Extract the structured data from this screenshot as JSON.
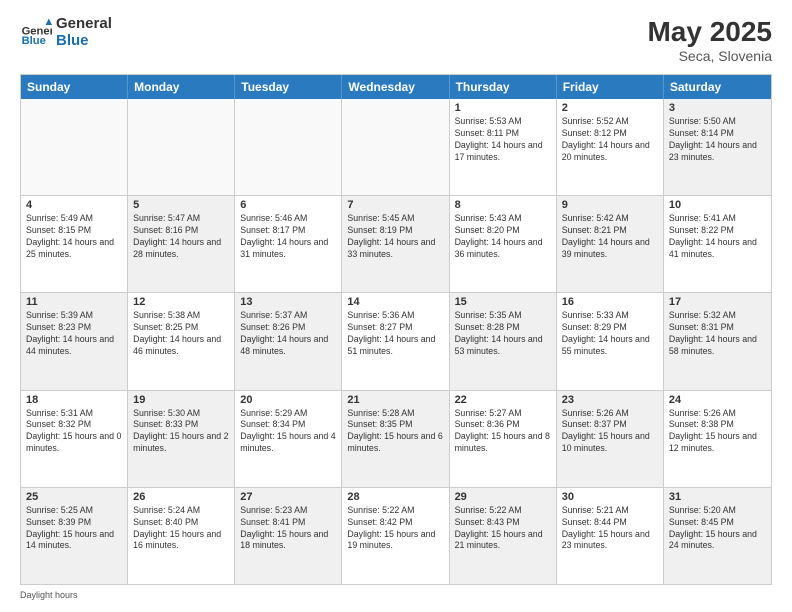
{
  "header": {
    "logo_general": "General",
    "logo_blue": "Blue",
    "month_year": "May 2025",
    "location": "Seca, Slovenia"
  },
  "days_of_week": [
    "Sunday",
    "Monday",
    "Tuesday",
    "Wednesday",
    "Thursday",
    "Friday",
    "Saturday"
  ],
  "rows": [
    [
      {
        "day": "",
        "info": "",
        "shade": true
      },
      {
        "day": "",
        "info": "",
        "shade": true
      },
      {
        "day": "",
        "info": "",
        "shade": true
      },
      {
        "day": "",
        "info": "",
        "shade": true
      },
      {
        "day": "1",
        "info": "Sunrise: 5:53 AM\nSunset: 8:11 PM\nDaylight: 14 hours\nand 17 minutes.",
        "shade": false
      },
      {
        "day": "2",
        "info": "Sunrise: 5:52 AM\nSunset: 8:12 PM\nDaylight: 14 hours\nand 20 minutes.",
        "shade": false
      },
      {
        "day": "3",
        "info": "Sunrise: 5:50 AM\nSunset: 8:14 PM\nDaylight: 14 hours\nand 23 minutes.",
        "shade": true
      }
    ],
    [
      {
        "day": "4",
        "info": "Sunrise: 5:49 AM\nSunset: 8:15 PM\nDaylight: 14 hours\nand 25 minutes.",
        "shade": false
      },
      {
        "day": "5",
        "info": "Sunrise: 5:47 AM\nSunset: 8:16 PM\nDaylight: 14 hours\nand 28 minutes.",
        "shade": true
      },
      {
        "day": "6",
        "info": "Sunrise: 5:46 AM\nSunset: 8:17 PM\nDaylight: 14 hours\nand 31 minutes.",
        "shade": false
      },
      {
        "day": "7",
        "info": "Sunrise: 5:45 AM\nSunset: 8:19 PM\nDaylight: 14 hours\nand 33 minutes.",
        "shade": true
      },
      {
        "day": "8",
        "info": "Sunrise: 5:43 AM\nSunset: 8:20 PM\nDaylight: 14 hours\nand 36 minutes.",
        "shade": false
      },
      {
        "day": "9",
        "info": "Sunrise: 5:42 AM\nSunset: 8:21 PM\nDaylight: 14 hours\nand 39 minutes.",
        "shade": true
      },
      {
        "day": "10",
        "info": "Sunrise: 5:41 AM\nSunset: 8:22 PM\nDaylight: 14 hours\nand 41 minutes.",
        "shade": false
      }
    ],
    [
      {
        "day": "11",
        "info": "Sunrise: 5:39 AM\nSunset: 8:23 PM\nDaylight: 14 hours\nand 44 minutes.",
        "shade": true
      },
      {
        "day": "12",
        "info": "Sunrise: 5:38 AM\nSunset: 8:25 PM\nDaylight: 14 hours\nand 46 minutes.",
        "shade": false
      },
      {
        "day": "13",
        "info": "Sunrise: 5:37 AM\nSunset: 8:26 PM\nDaylight: 14 hours\nand 48 minutes.",
        "shade": true
      },
      {
        "day": "14",
        "info": "Sunrise: 5:36 AM\nSunset: 8:27 PM\nDaylight: 14 hours\nand 51 minutes.",
        "shade": false
      },
      {
        "day": "15",
        "info": "Sunrise: 5:35 AM\nSunset: 8:28 PM\nDaylight: 14 hours\nand 53 minutes.",
        "shade": true
      },
      {
        "day": "16",
        "info": "Sunrise: 5:33 AM\nSunset: 8:29 PM\nDaylight: 14 hours\nand 55 minutes.",
        "shade": false
      },
      {
        "day": "17",
        "info": "Sunrise: 5:32 AM\nSunset: 8:31 PM\nDaylight: 14 hours\nand 58 minutes.",
        "shade": true
      }
    ],
    [
      {
        "day": "18",
        "info": "Sunrise: 5:31 AM\nSunset: 8:32 PM\nDaylight: 15 hours\nand 0 minutes.",
        "shade": false
      },
      {
        "day": "19",
        "info": "Sunrise: 5:30 AM\nSunset: 8:33 PM\nDaylight: 15 hours\nand 2 minutes.",
        "shade": true
      },
      {
        "day": "20",
        "info": "Sunrise: 5:29 AM\nSunset: 8:34 PM\nDaylight: 15 hours\nand 4 minutes.",
        "shade": false
      },
      {
        "day": "21",
        "info": "Sunrise: 5:28 AM\nSunset: 8:35 PM\nDaylight: 15 hours\nand 6 minutes.",
        "shade": true
      },
      {
        "day": "22",
        "info": "Sunrise: 5:27 AM\nSunset: 8:36 PM\nDaylight: 15 hours\nand 8 minutes.",
        "shade": false
      },
      {
        "day": "23",
        "info": "Sunrise: 5:26 AM\nSunset: 8:37 PM\nDaylight: 15 hours\nand 10 minutes.",
        "shade": true
      },
      {
        "day": "24",
        "info": "Sunrise: 5:26 AM\nSunset: 8:38 PM\nDaylight: 15 hours\nand 12 minutes.",
        "shade": false
      }
    ],
    [
      {
        "day": "25",
        "info": "Sunrise: 5:25 AM\nSunset: 8:39 PM\nDaylight: 15 hours\nand 14 minutes.",
        "shade": true
      },
      {
        "day": "26",
        "info": "Sunrise: 5:24 AM\nSunset: 8:40 PM\nDaylight: 15 hours\nand 16 minutes.",
        "shade": false
      },
      {
        "day": "27",
        "info": "Sunrise: 5:23 AM\nSunset: 8:41 PM\nDaylight: 15 hours\nand 18 minutes.",
        "shade": true
      },
      {
        "day": "28",
        "info": "Sunrise: 5:22 AM\nSunset: 8:42 PM\nDaylight: 15 hours\nand 19 minutes.",
        "shade": false
      },
      {
        "day": "29",
        "info": "Sunrise: 5:22 AM\nSunset: 8:43 PM\nDaylight: 15 hours\nand 21 minutes.",
        "shade": true
      },
      {
        "day": "30",
        "info": "Sunrise: 5:21 AM\nSunset: 8:44 PM\nDaylight: 15 hours\nand 23 minutes.",
        "shade": false
      },
      {
        "day": "31",
        "info": "Sunrise: 5:20 AM\nSunset: 8:45 PM\nDaylight: 15 hours\nand 24 minutes.",
        "shade": true
      }
    ]
  ],
  "footer": {
    "daylight_label": "Daylight hours"
  }
}
